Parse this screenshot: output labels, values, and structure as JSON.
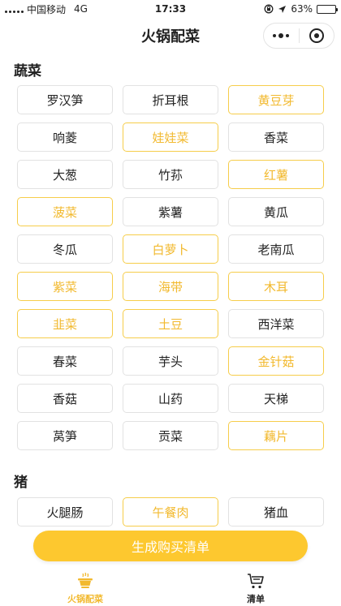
{
  "status": {
    "carrier": "中国移动",
    "network": "4G",
    "time": "17:33",
    "battery": "63%",
    "battery_level": 0.63
  },
  "nav": {
    "title": "火锅配菜"
  },
  "sections": [
    {
      "title": "蔬菜",
      "items": [
        {
          "label": "罗汉笋",
          "selected": false
        },
        {
          "label": "折耳根",
          "selected": false
        },
        {
          "label": "黄豆芽",
          "selected": true
        },
        {
          "label": "响菱",
          "selected": false
        },
        {
          "label": "娃娃菜",
          "selected": true
        },
        {
          "label": "香菜",
          "selected": false
        },
        {
          "label": "大葱",
          "selected": false
        },
        {
          "label": "竹荪",
          "selected": false
        },
        {
          "label": "红薯",
          "selected": true
        },
        {
          "label": "菠菜",
          "selected": true
        },
        {
          "label": "紫薯",
          "selected": false
        },
        {
          "label": "黄瓜",
          "selected": false
        },
        {
          "label": "冬瓜",
          "selected": false
        },
        {
          "label": "白萝卜",
          "selected": true
        },
        {
          "label": "老南瓜",
          "selected": false
        },
        {
          "label": "紫菜",
          "selected": true
        },
        {
          "label": "海带",
          "selected": true
        },
        {
          "label": "木耳",
          "selected": true
        },
        {
          "label": "韭菜",
          "selected": true
        },
        {
          "label": "土豆",
          "selected": true
        },
        {
          "label": "西洋菜",
          "selected": false
        },
        {
          "label": "春菜",
          "selected": false
        },
        {
          "label": "芋头",
          "selected": false
        },
        {
          "label": "金针菇",
          "selected": true
        },
        {
          "label": "香菇",
          "selected": false
        },
        {
          "label": "山药",
          "selected": false
        },
        {
          "label": "天梯",
          "selected": false
        },
        {
          "label": "莴笋",
          "selected": false
        },
        {
          "label": "贡菜",
          "selected": false
        },
        {
          "label": "藕片",
          "selected": true
        }
      ]
    },
    {
      "title": "猪",
      "items": [
        {
          "label": "火腿肠",
          "selected": false
        },
        {
          "label": "午餐肉",
          "selected": true
        },
        {
          "label": "猪血",
          "selected": false
        }
      ]
    }
  ],
  "cta": {
    "label": "生成购买清单"
  },
  "tabs": [
    {
      "label": "火锅配菜",
      "icon": "hotpot-icon",
      "active": true
    },
    {
      "label": "清单",
      "icon": "cart-icon",
      "active": false
    }
  ],
  "colors": {
    "accent": "#fdc82f",
    "selected_text": "#f2b92e",
    "selected_border": "#f6cd4a"
  }
}
